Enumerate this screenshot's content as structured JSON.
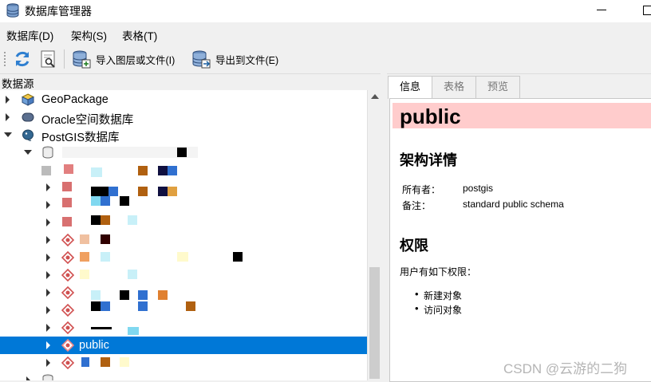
{
  "window": {
    "title": "数据库管理器"
  },
  "menu": [
    {
      "label": "数据库(D)"
    },
    {
      "label": "架构(S)"
    },
    {
      "label": "表格(T)"
    }
  ],
  "toolbar": {
    "import_label": "导入图层或文件(I)",
    "export_label": "导出到文件(E)"
  },
  "panel": {
    "title": "数据源"
  },
  "tree": {
    "geopackage": "GeoPackage",
    "oracle": "Oracle空间数据库",
    "postgis": "PostGIS数据库",
    "selected_schema": "public"
  },
  "tabs": [
    {
      "label": "信息"
    },
    {
      "label": "表格"
    },
    {
      "label": "预览"
    }
  ],
  "info": {
    "schema_name": "public",
    "details_heading": "架构详情",
    "owner_label": "所有者：",
    "owner_value": "postgis",
    "comment_label": "备注：",
    "comment_value": "standard public schema",
    "privileges_heading": "权限",
    "privileges_intro": "用户有如下权限：",
    "privileges": [
      "新建对象",
      "访问对象"
    ]
  },
  "watermark": "CSDN @云游的二狗",
  "colors": {
    "selection": "#0078d7",
    "schema_header_bg": "#ffcccc"
  },
  "icons": [
    "database-icon",
    "refresh-icon",
    "info-icon",
    "import-icon",
    "export-icon",
    "geopackage-icon",
    "oracle-icon",
    "postgis-icon",
    "schema-icon"
  ]
}
